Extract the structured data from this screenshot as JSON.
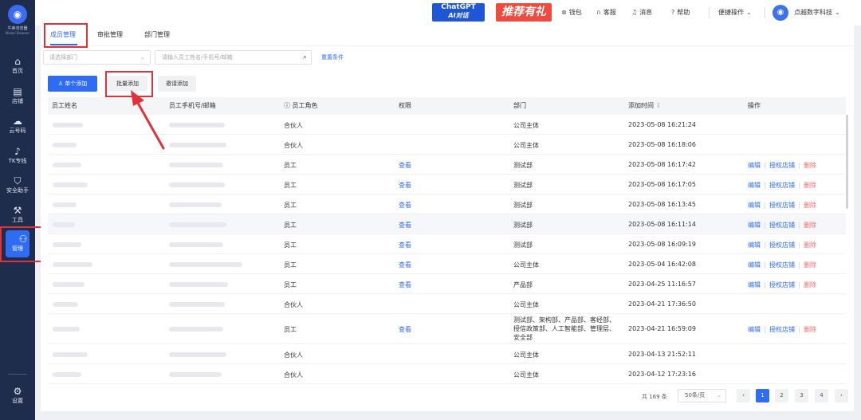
{
  "sidebar": {
    "logo_name": "牛卖浏览器",
    "logo_en": "Niubai Browser",
    "items": [
      {
        "label": "首页",
        "icon": "home-icon",
        "glyph": "⌂"
      },
      {
        "label": "店铺",
        "icon": "store-icon",
        "glyph": "▤"
      },
      {
        "label": "云号码",
        "icon": "cloud-phone-icon",
        "glyph": "☁"
      },
      {
        "label": "TK专线",
        "icon": "tiktok-icon",
        "glyph": "♪"
      },
      {
        "label": "安全助手",
        "icon": "shield-icon",
        "glyph": "⛉"
      },
      {
        "label": "工具",
        "icon": "wrench-icon",
        "glyph": "⚒"
      },
      {
        "label": "管理",
        "icon": "people-icon",
        "glyph": "⚇"
      },
      {
        "label": "设置",
        "icon": "gear-icon",
        "glyph": "⚙"
      }
    ]
  },
  "topbar": {
    "chatgpt_line1": "ChatGPT",
    "chatgpt_line2": "AI对话",
    "promo": "推荐有礼",
    "wallet": "钱包",
    "service": "客服",
    "messages": "消息",
    "help": "帮助",
    "quick_ops": "便捷操作",
    "company": "点越数字科技"
  },
  "tabs": [
    "成员管理",
    "审批管理",
    "部门管理"
  ],
  "filters": {
    "dept_placeholder": "请选择部门",
    "search_placeholder": "请输入员工姓名/手机号/邮箱",
    "reset": "重置条件"
  },
  "actions": {
    "single_add": "单个添加",
    "batch_add": "批量添加",
    "invite_add": "邀请添加"
  },
  "table": {
    "headers": [
      "员工姓名",
      "员工手机号/邮箱",
      "员工角色",
      "权限",
      "部门",
      "添加时间",
      "操作"
    ],
    "view_label": "查看",
    "edit_label": "编辑",
    "auth_label": "授权店铺",
    "delete_label": "删除",
    "rows": [
      {
        "role": "合伙人",
        "perm": "",
        "dept": "公司主体",
        "time": "2023-05-08 16:21:24",
        "ops": false
      },
      {
        "role": "合伙人",
        "perm": "",
        "dept": "公司主体",
        "time": "2023-05-08 16:18:06",
        "ops": false
      },
      {
        "role": "员工",
        "perm": "查看",
        "dept": "测试部",
        "time": "2023-05-08 16:17:42",
        "ops": true
      },
      {
        "role": "员工",
        "perm": "查看",
        "dept": "测试部",
        "time": "2023-05-08 16:17:05",
        "ops": true
      },
      {
        "role": "员工",
        "perm": "查看",
        "dept": "测试部",
        "time": "2023-05-08 16:13:45",
        "ops": true
      },
      {
        "role": "员工",
        "perm": "查看",
        "dept": "测试部",
        "time": "2023-05-08 16:11:14",
        "ops": true
      },
      {
        "role": "员工",
        "perm": "查看",
        "dept": "测试部",
        "time": "2023-05-08 16:09:19",
        "ops": true
      },
      {
        "role": "员工",
        "perm": "查看",
        "dept": "公司主体",
        "time": "2023-05-04 16:42:08",
        "ops": true
      },
      {
        "role": "员工",
        "perm": "查看",
        "dept": "产品部",
        "time": "2023-04-25 11:16:57",
        "ops": true
      },
      {
        "role": "合伙人",
        "perm": "",
        "dept": "公司主体",
        "time": "2023-04-21 17:36:50",
        "ops": false
      },
      {
        "role": "员工",
        "perm": "查看",
        "dept": "测试部、架构部、产品部、客经部、授信政策部、人工智能部、管理层、安全部",
        "time": "2023-04-21 16:59:09",
        "ops": true
      },
      {
        "role": "合伙人",
        "perm": "",
        "dept": "公司主体",
        "time": "2023-04-13 21:52:11",
        "ops": false
      },
      {
        "role": "合伙人",
        "perm": "",
        "dept": "公司主体",
        "time": "2023-04-12 17:23:16",
        "ops": false
      }
    ]
  },
  "pagination": {
    "total": "共 169 条",
    "page_size": "50条/页",
    "pages": [
      "1",
      "2",
      "3",
      "4"
    ],
    "prev": "‹",
    "next": "›"
  }
}
